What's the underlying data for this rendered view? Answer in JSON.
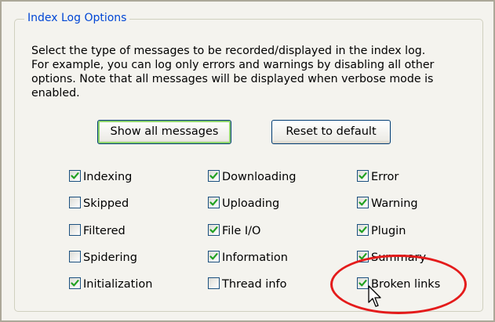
{
  "group": {
    "title": "Index Log Options"
  },
  "description": {
    "lines": [
      "Select the type of messages to be recorded/displayed in the index log.",
      "For example, you can log only errors and warnings by disabling all other",
      "options. Note that all messages will be displayed when verbose mode is",
      "enabled."
    ]
  },
  "buttons": {
    "show_all": "Show all messages",
    "reset": "Reset to default"
  },
  "options": {
    "col1": [
      {
        "label": "Indexing",
        "checked": true
      },
      {
        "label": "Skipped",
        "checked": false
      },
      {
        "label": "Filtered",
        "checked": false
      },
      {
        "label": "Spidering",
        "checked": false
      },
      {
        "label": "Initialization",
        "checked": true
      }
    ],
    "col2": [
      {
        "label": "Downloading",
        "checked": true
      },
      {
        "label": "Uploading",
        "checked": true
      },
      {
        "label": "File I/O",
        "checked": true
      },
      {
        "label": "Information",
        "checked": true
      },
      {
        "label": "Thread info",
        "checked": false
      }
    ],
    "col3": [
      {
        "label": "Error",
        "checked": true
      },
      {
        "label": "Warning",
        "checked": true
      },
      {
        "label": "Plugin",
        "checked": true
      },
      {
        "label": "Summary",
        "checked": true
      },
      {
        "label": "Broken links",
        "checked": true
      }
    ]
  },
  "colors": {
    "accent": "#0046d5",
    "check": "#21a121",
    "highlight": "#e41b1b"
  },
  "icons": {
    "check": "checkmark-icon",
    "cursor": "mouse-pointer-icon"
  }
}
